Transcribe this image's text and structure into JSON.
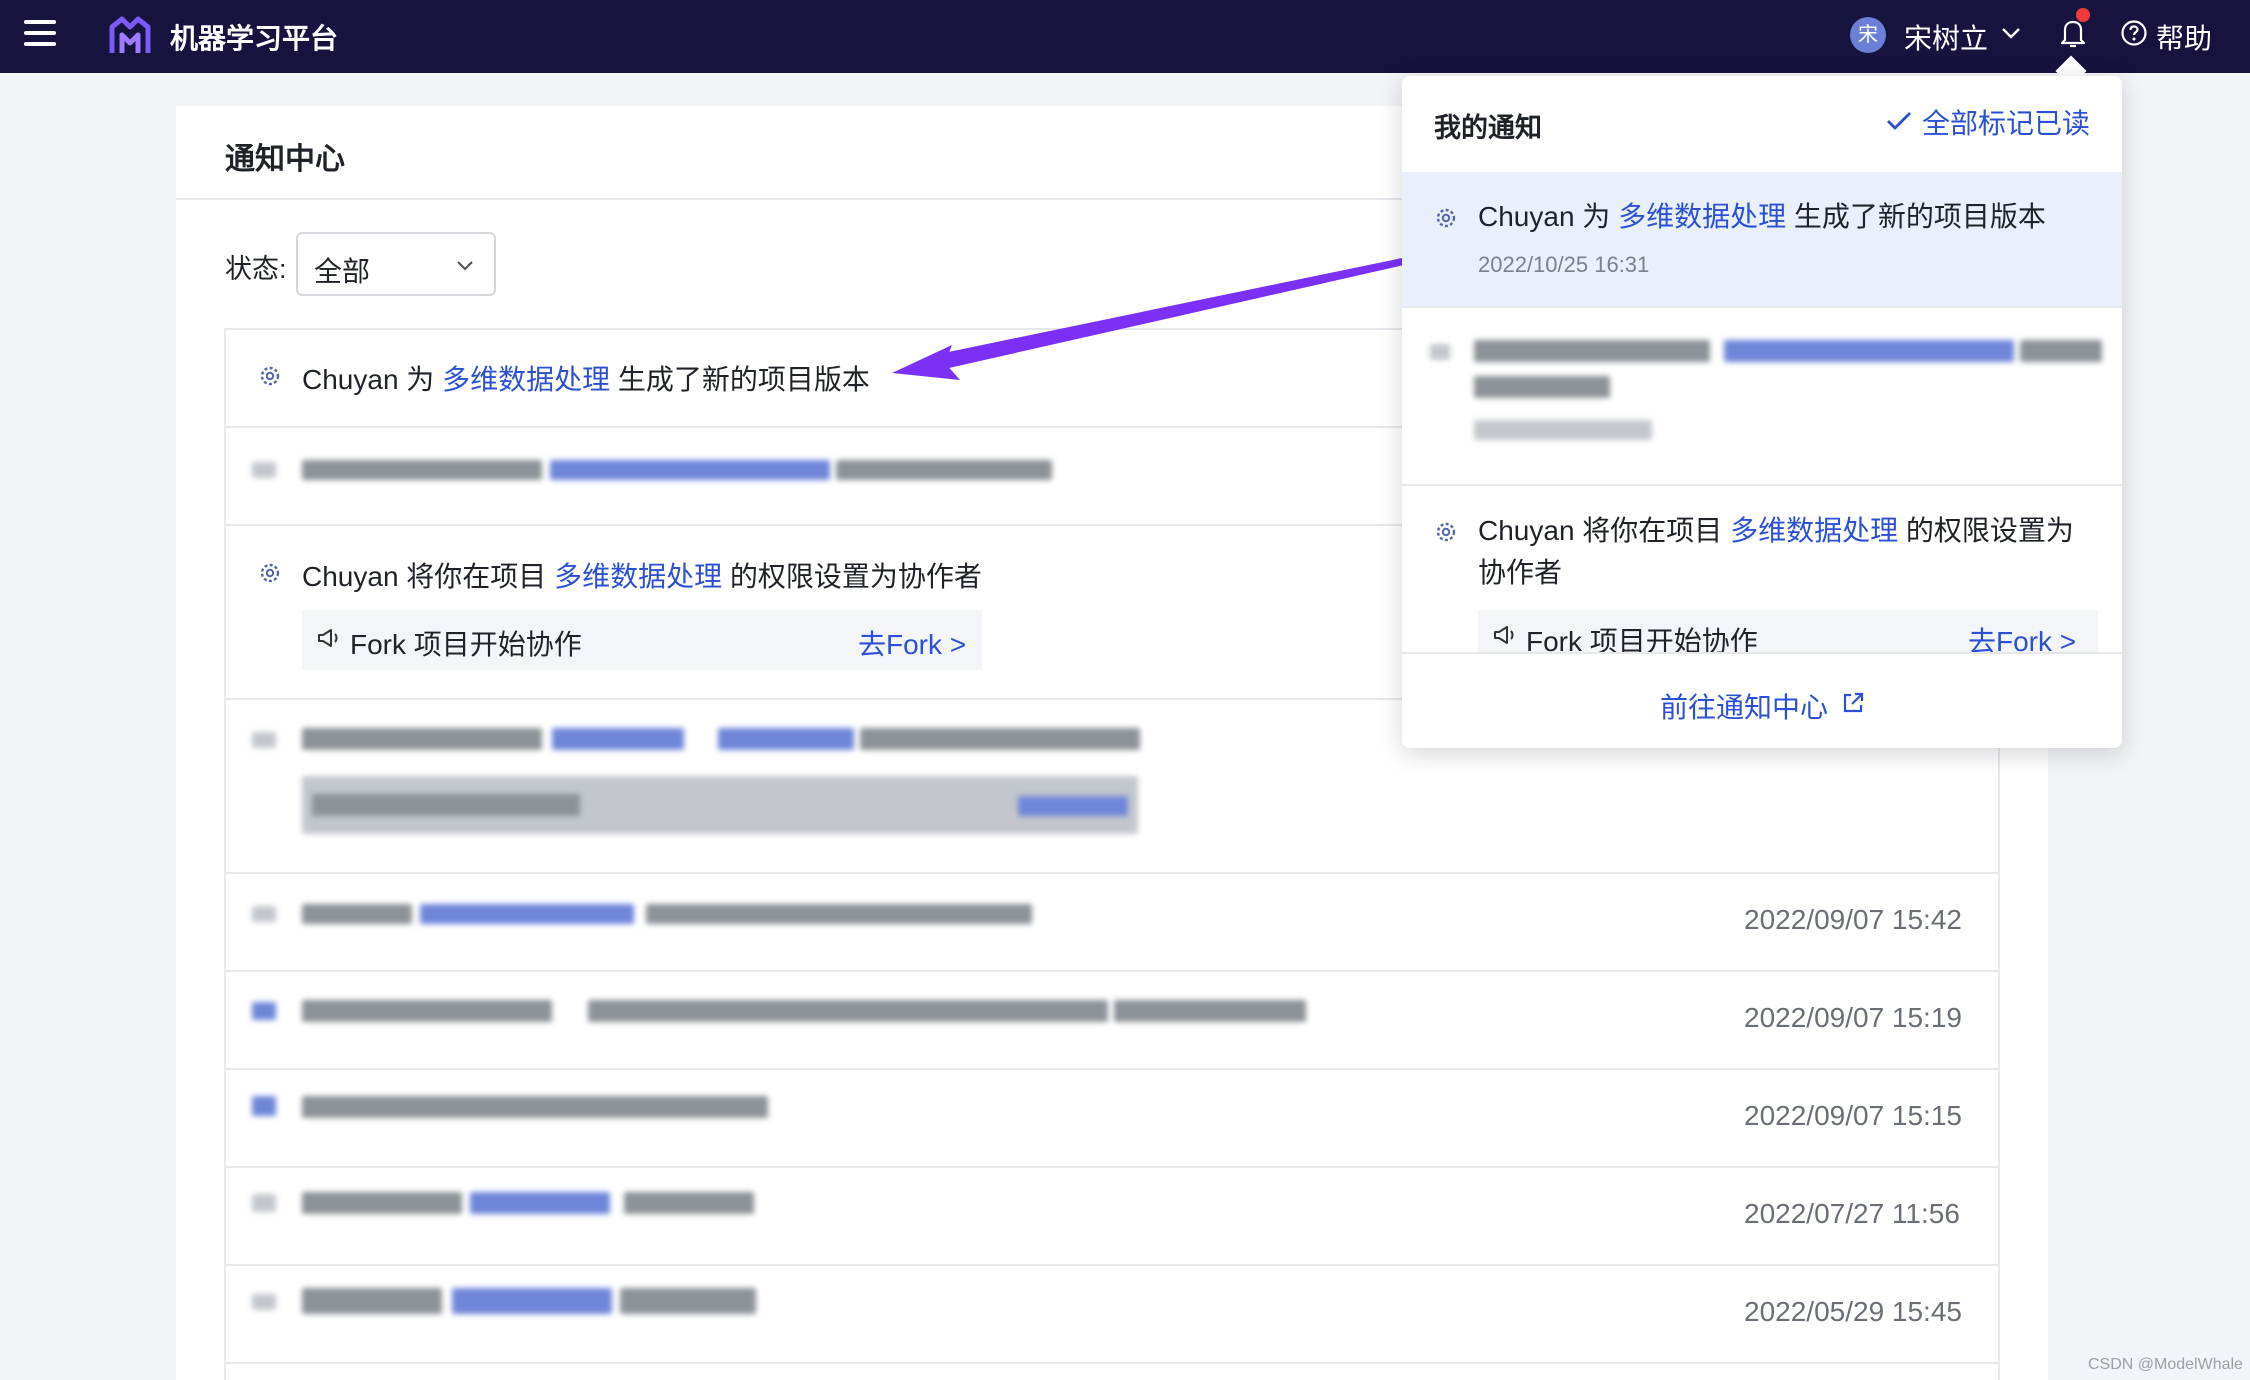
{
  "header": {
    "app_title": "机器学习平台",
    "user": {
      "avatar_text": "宋",
      "name": "宋树立"
    },
    "help_label": "帮助",
    "has_unread": true
  },
  "page": {
    "title": "通知中心",
    "filter": {
      "label": "状态:",
      "value": "全部"
    }
  },
  "notifications": [
    {
      "actor": "Chuyan",
      "pre": "为",
      "project": "多维数据处理",
      "post": "生成了新的项目版本"
    },
    {
      "actor": "Chuyan",
      "pre": "将你在项目",
      "project": "多维数据处理",
      "post": "的权限设置为协作者",
      "action": {
        "text": "Fork 项目开始协作",
        "link": "去Fork >"
      }
    }
  ],
  "row_times": [
    "2022/09/07 15:42",
    "2022/09/07 15:19",
    "2022/09/07 15:15",
    "2022/07/27 11:56",
    "2022/05/29 15:45"
  ],
  "dropdown": {
    "title": "我的通知",
    "mark_all_read": "全部标记已读",
    "item1": {
      "actor": "Chuyan",
      "pre": "为",
      "project": "多维数据处理",
      "post": "生成了新的项目版本",
      "time": "2022/10/25 16:31"
    },
    "item2": {
      "actor": "Chuyan",
      "pre": "将你在项目",
      "project": "多维数据处理",
      "post": "的权限设置为",
      "post2": "协作者",
      "action": {
        "text": "Fork 项目开始协作",
        "link": "去Fork >"
      }
    },
    "footer": "前往通知中心"
  },
  "watermark": "CSDN @ModelWhale",
  "colors": {
    "header_bg": "#17133f",
    "link": "#2b50d6",
    "arrow": "#7b2ff7",
    "unread_dot": "#f03a3a"
  }
}
